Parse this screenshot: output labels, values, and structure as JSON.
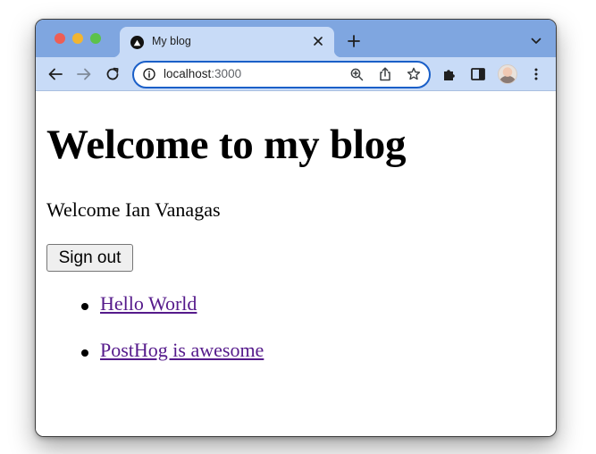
{
  "browser": {
    "tab": {
      "title": "My blog"
    },
    "address_bar": {
      "host": "localhost",
      "port": ":3000"
    }
  },
  "page": {
    "heading": "Welcome to my blog",
    "welcome_text": "Welcome Ian Vanagas",
    "sign_out_label": "Sign out",
    "posts": [
      {
        "title": "Hello World"
      },
      {
        "title": "PostHog is awesome"
      }
    ]
  },
  "colors": {
    "tabstrip": "#7fa6e0",
    "toolbar": "#c8dbf7",
    "omnibox_border": "#1a5fc8",
    "visited_link": "#551a8b"
  },
  "icons": [
    "nextjs-favicon-icon",
    "close-icon",
    "plus-icon",
    "chevron-down-icon",
    "back-arrow-icon",
    "forward-arrow-icon",
    "reload-icon",
    "info-icon",
    "zoom-icon",
    "share-icon",
    "star-icon",
    "puzzle-icon",
    "side-panel-icon",
    "kebab-menu-icon"
  ]
}
